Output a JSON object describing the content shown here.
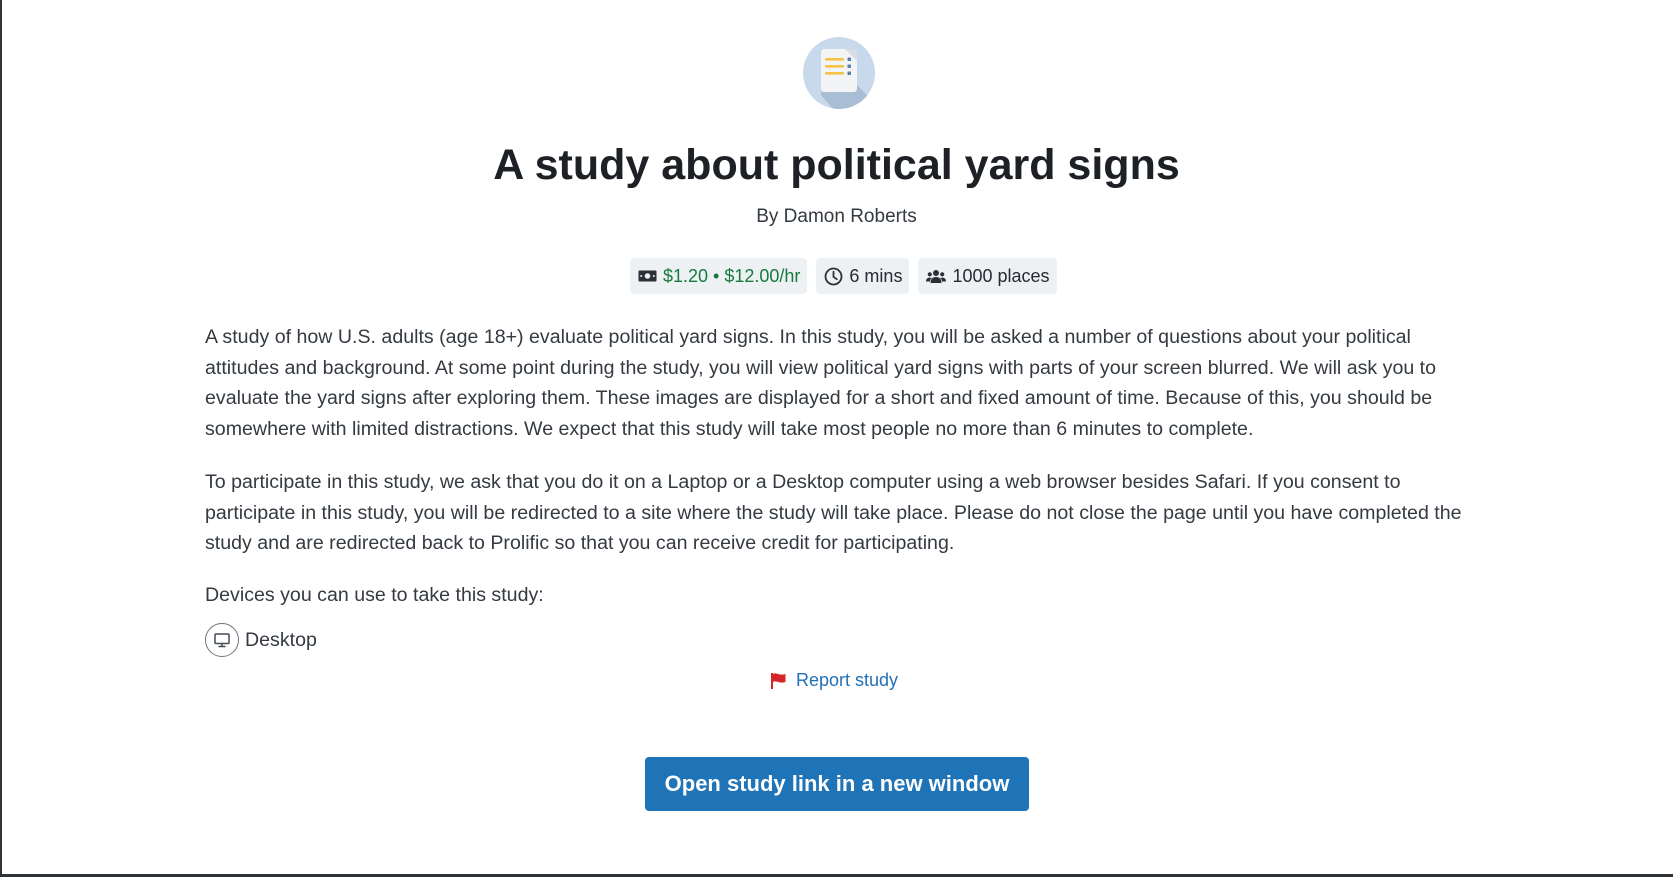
{
  "study": {
    "icon": "document-checklist-icon",
    "title": "A study about political yard signs",
    "author": "By Damon Roberts"
  },
  "meta": {
    "reward": {
      "icon": "money-icon",
      "text": "$1.20 • $12.00/hr",
      "color": "#167a3e"
    },
    "duration": {
      "icon": "clock-icon",
      "text": "6 mins"
    },
    "places": {
      "icon": "users-icon",
      "text": "1000 places"
    }
  },
  "description": {
    "paragraphs": [
      "A study of how U.S. adults (age 18+) evaluate political yard signs. In this study, you will be asked a number of questions about your political attitudes and background. At some point during the study, you will view political yard signs with parts of your screen blurred. We will ask you to evaluate the yard signs after exploring them. These images are displayed for a  short and fixed amount of time. Because of this, you should be somewhere with limited distractions. We expect that this study will take most people no more than 6 minutes to complete.",
      "To participate in this study, we ask that you do it on a Laptop or a Desktop computer using a web browser besides Safari. If you consent to participate in this study, you will be redirected to a site where the study will take place. Please do not close the page until you have completed the study and are redirected back to Prolific so that you can receive credit for participating."
    ]
  },
  "devices": {
    "label": "Devices you can use to take this study:",
    "items": [
      {
        "icon": "monitor-icon",
        "label": "Desktop"
      }
    ]
  },
  "report": {
    "icon": "flag-icon",
    "label": "Report study",
    "icon_color": "#d7262b"
  },
  "actions": {
    "open_label": "Open study link in a new window",
    "accent": "#1f73b7"
  }
}
